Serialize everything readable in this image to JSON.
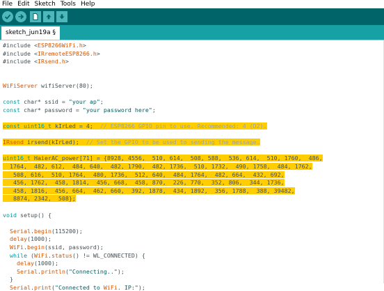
{
  "menu": [
    "File",
    "Edit",
    "Sketch",
    "Tools",
    "Help"
  ],
  "toolbar": {
    "buttons": [
      "verify-icon",
      "upload-icon",
      "new-icon",
      "open-icon",
      "save-icon"
    ],
    "accent": "#006468"
  },
  "tab": {
    "label": "sketch_jun19a §"
  },
  "code": [
    "#include <ESP8266WiFi.h>",
    "#include <IRremoteESP8266.h>",
    "#include <IRsend.h>",
    "",
    "",
    "WiFiServer wifiServer(80);",
    "",
    "const char* ssid = \"your ap\";",
    "const char* password = \"your password here\";",
    "",
    "const uint16_t kIrLed = 4;  // ESP8266 GPIO pin to use. Recommended: 4 (D2).",
    "",
    "IRsend irsend(kIrLed);  // Set the GPIO to be used to sending the message.",
    "",
    "uint16_t HaierAC_power[71] = {8928, 4556,  510, 614,  508, 588,  536, 614,  510, 1760,  486,",
    "  1764,  482, 612,  484, 640,  482, 1790,  482, 1736,  510, 1732,  490, 1758,  484, 1762,",
    "   508, 616,  510, 1764,  480, 1736,  512, 640,  484, 1764,  482, 664,  432, 692,",
    "   456, 1762,  458, 1814,  456, 668,  458, 870,  226, 770,  352, 806,  344, 1736,",
    "   458, 1816,  456, 664,  462, 660,  392, 1878,  434, 1892,  356, 1788,  388, 39482,",
    "   8874, 2342,  508};",
    "",
    "void setup() {",
    "",
    "  Serial.begin(115200);",
    "  delay(1000);",
    "  WiFi.begin(ssid, password);",
    "  while (WiFi.status() != WL_CONNECTED) {",
    "    delay(1000);",
    "    Serial.println(\"Connecting..\");",
    "  }",
    "  Serial.print(\"Connected to WiFi. IP:\");"
  ]
}
